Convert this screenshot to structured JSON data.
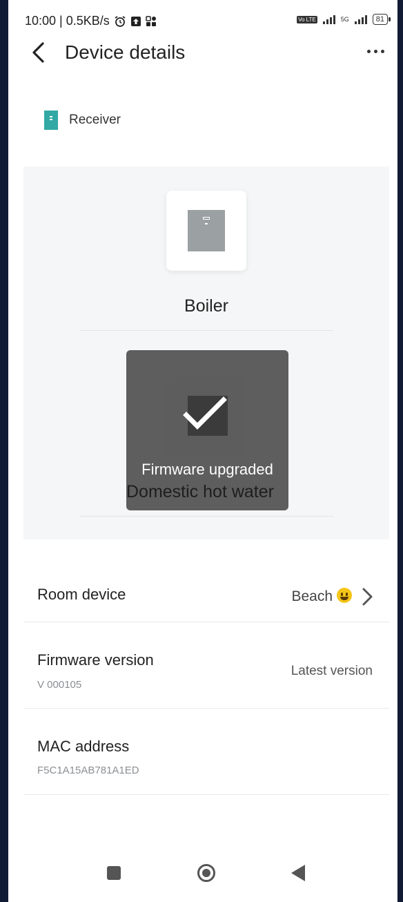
{
  "status_bar": {
    "left_text": "10:00 | 0.5KB/s",
    "volte": "Vo LTE",
    "network": "5G",
    "battery": "81"
  },
  "header": {
    "title": "Device details"
  },
  "device": {
    "type_label": "Receiver",
    "name": "Boiler",
    "function": "Domestic hot water"
  },
  "toast": {
    "message": "Firmware upgraded"
  },
  "rows": {
    "room_device": {
      "title": "Room device",
      "value": "Beach"
    },
    "firmware": {
      "title": "Firmware version",
      "sub": "V 000105",
      "value": "Latest version"
    },
    "mac": {
      "title": "MAC address",
      "sub": "F5C1A15AB781A1ED"
    }
  },
  "colors": {
    "accent_teal": "#33a9a5",
    "background_frame": "#111b33"
  },
  "icons": [
    "back-arrow-icon",
    "more-options-icon",
    "receiver-icon",
    "boiler-icon",
    "checkmark-icon",
    "smiley-emoji-icon",
    "chevron-right-icon",
    "recents-icon",
    "home-icon",
    "back-triangle-icon"
  ]
}
